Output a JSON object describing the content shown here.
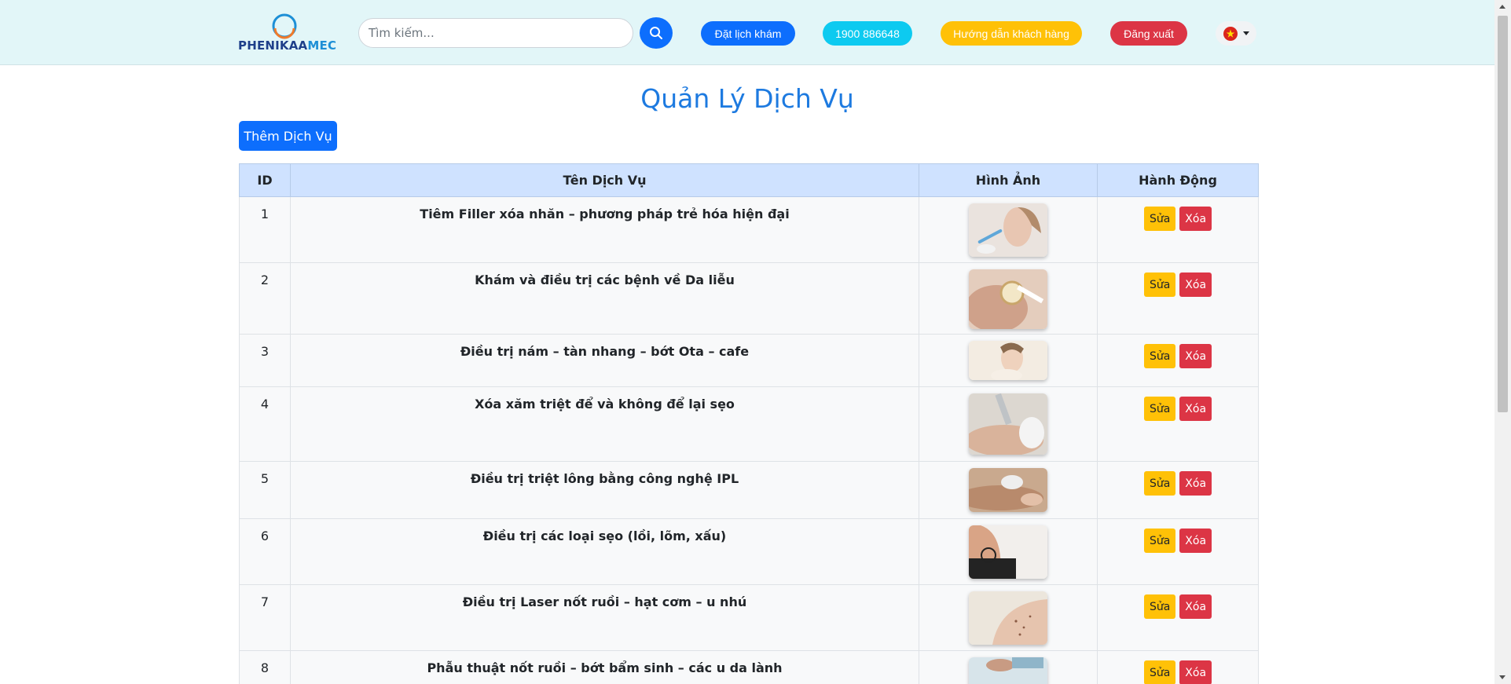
{
  "header": {
    "logo": {
      "part1": "PHENIKAA",
      "part2": "MEC"
    },
    "search": {
      "placeholder": "Tìm kiếm..."
    },
    "book_label": "Đặt lịch khám",
    "phone_label": "1900 886648",
    "guide_label": "Hướng dẫn khách hàng",
    "logout_label": "Đăng xuất",
    "language_icon": "vietnam-flag-icon"
  },
  "page": {
    "title": "Quản Lý Dịch Vụ",
    "add_button": "Thêm Dịch Vụ"
  },
  "table": {
    "columns": [
      "ID",
      "Tên Dịch Vụ",
      "Hình Ảnh",
      "Hành Động"
    ],
    "edit_label": "Sửa",
    "delete_label": "Xóa",
    "rows": [
      {
        "id": "1",
        "name": "Tiêm Filler xóa nhăn – phương pháp trẻ hóa hiện đại"
      },
      {
        "id": "2",
        "name": "Khám và điều trị các bệnh về Da liễu"
      },
      {
        "id": "3",
        "name": "Điều trị nám – tàn nhang – bớt Ota – cafe"
      },
      {
        "id": "4",
        "name": "Xóa xăm triệt để và không để lại sẹo"
      },
      {
        "id": "5",
        "name": "Điều trị triệt lông bằng công nghệ IPL"
      },
      {
        "id": "6",
        "name": "Điều trị các loại sẹo (lồi, lõm, xấu)"
      },
      {
        "id": "7",
        "name": "Điều trị Laser nốt ruồi – hạt cơm – u nhú"
      },
      {
        "id": "8",
        "name": "Phẫu thuật nốt ruồi – bớt bẩm sinh – các u da lành"
      }
    ]
  },
  "colors": {
    "navbar_bg": "#e2f6f8",
    "primary": "#0d6efd",
    "info": "#0dcaf0",
    "warning": "#ffc107",
    "danger": "#dc3545",
    "title": "#1d7ae0",
    "table_header": "#cfe2ff"
  }
}
